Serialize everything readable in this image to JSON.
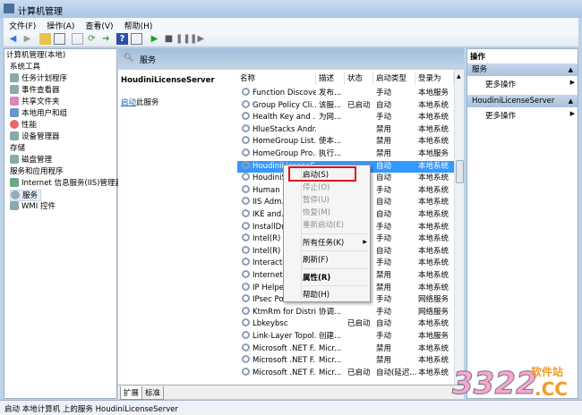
{
  "window": {
    "title": "计算机管理"
  },
  "menu": [
    "文件(F)",
    "操作(A)",
    "查看(V)",
    "帮助(H)"
  ],
  "tree": {
    "root": "计算机管理(本地)",
    "items": [
      {
        "label": "系统工具",
        "level": 1
      },
      {
        "label": "任务计划程序",
        "level": 2
      },
      {
        "label": "事件查看器",
        "level": 2
      },
      {
        "label": "共享文件夹",
        "level": 2
      },
      {
        "label": "本地用户和组",
        "level": 2
      },
      {
        "label": "性能",
        "level": 2
      },
      {
        "label": "设备管理器",
        "level": 2
      },
      {
        "label": "存储",
        "level": 1
      },
      {
        "label": "磁盘管理",
        "level": 2
      },
      {
        "label": "服务和应用程序",
        "level": 1
      },
      {
        "label": "Internet 信息服务(IIS)管理器",
        "level": 2
      },
      {
        "label": "服务",
        "level": 2,
        "selected": true
      },
      {
        "label": "WMI 控件",
        "level": 2
      }
    ]
  },
  "center": {
    "header": "服务",
    "service_name": "HoudiniLicenseServer",
    "start_link": "启动",
    "start_suffix": "此服务"
  },
  "columns": [
    "名称",
    "描述",
    "状态",
    "启动类型",
    "登录为"
  ],
  "rows": [
    [
      "Function Discove...",
      "发布...",
      "",
      "手动",
      "本地服务"
    ],
    [
      "Group Policy Cli...",
      "该服...",
      "已启动",
      "自动",
      "本地系统"
    ],
    [
      "Health Key and ...",
      "为网...",
      "",
      "手动",
      "本地系统"
    ],
    [
      "HlueStacks Andr...",
      "",
      "",
      "禁用",
      "本地系统"
    ],
    [
      "HomeGroup List...",
      "使本...",
      "",
      "禁用",
      "本地系统"
    ],
    [
      "HomeGroup Pro...",
      "执行...",
      "",
      "禁用",
      "本地服务"
    ],
    [
      "HoudiniLicenseS...",
      "",
      "",
      "自动",
      "本地系统"
    ],
    [
      "HoudiniS...",
      "",
      "",
      "自动",
      "本地系统"
    ],
    [
      "Human I...",
      "",
      "",
      "手动",
      "本地系统"
    ],
    [
      "IIS Adm...",
      "",
      "",
      "自动",
      "本地系统"
    ],
    [
      "IKE and...",
      "",
      "",
      "自动",
      "本地系统"
    ],
    [
      "InstallDr...",
      "",
      "",
      "手动",
      "本地系统"
    ],
    [
      "Intel(R) ...",
      "",
      "",
      "手动",
      "本地系统"
    ],
    [
      "Intel(R) ...",
      "",
      "",
      "自动",
      "本地系统"
    ],
    [
      "Interacti...",
      "",
      "",
      "手动",
      "本地系统"
    ],
    [
      "Internet ...",
      "",
      "",
      "禁用",
      "本地系统"
    ],
    [
      "IP Helpe...",
      "",
      "",
      "禁用",
      "本地系统"
    ],
    [
      "IPsec Po...",
      "",
      "",
      "手动",
      "网络服务"
    ],
    [
      "KtmRm for Distri...",
      "协调...",
      "",
      "手动",
      "网络服务"
    ],
    [
      "Lbkeybsc",
      "",
      "已启动",
      "自动",
      "本地系统"
    ],
    [
      "Link-Layer Topol...",
      "创建...",
      "",
      "手动",
      "本地服务"
    ],
    [
      "Microsoft .NET F...",
      "Micr...",
      "",
      "禁用",
      "本地系统"
    ],
    [
      "Microsoft .NET F...",
      "Micr...",
      "",
      "禁用",
      "本地系统"
    ],
    [
      "Microsoft .NET F...",
      "Micr...",
      "已启动",
      "自动(延迟...",
      "本地系统"
    ]
  ],
  "context_menu": [
    {
      "label": "启动(S)",
      "disabled": false
    },
    {
      "label": "停止(O)",
      "disabled": true
    },
    {
      "label": "暂停(U)",
      "disabled": true
    },
    {
      "label": "恢复(M)",
      "disabled": true
    },
    {
      "label": "重新启动(E)",
      "disabled": true
    },
    {
      "label": "所有任务(K)",
      "submenu": true
    },
    {
      "label": "刷新(F)"
    },
    {
      "label": "属性(R)",
      "bold": true
    },
    {
      "label": "帮助(H)"
    }
  ],
  "tabs": [
    "扩展",
    "标准"
  ],
  "actions": {
    "title": "操作",
    "sections": [
      {
        "header": "服务",
        "item": "更多操作"
      },
      {
        "header": "HoudiniLicenseServer",
        "item": "更多操作"
      }
    ]
  },
  "status": "启动 本地计算机 上的服务 HoudiniLicenseServer",
  "watermark": {
    "text": "3322",
    "sub": "软件站",
    ".cc": ".CC"
  },
  "colors": {
    "selection": "#3399ff",
    "highlight_box": "#e0101a"
  }
}
